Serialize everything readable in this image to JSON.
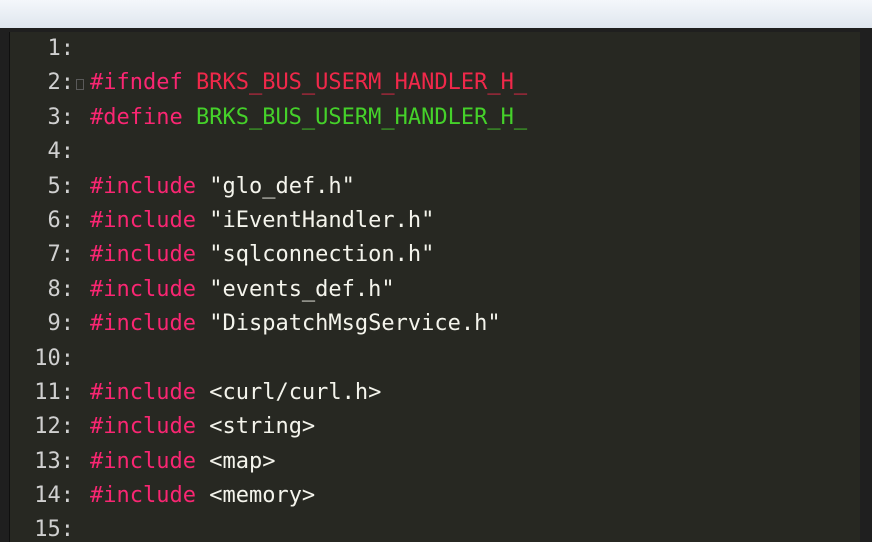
{
  "colors": {
    "background": "#272822",
    "keyword": "#f92672",
    "guard_macro": "#f0284a",
    "define_macro": "#45d12a",
    "text": "#f4f4ec",
    "line_number": "#d0d0d0"
  },
  "icons": {
    "fold_marker": "fold-marker-icon"
  },
  "lines": [
    {
      "num": "1:",
      "kw": "",
      "rest": ""
    },
    {
      "num": "2:",
      "kw": "#ifndef",
      "rest": "BRKS_BUS_USERM_HANDLER_H_"
    },
    {
      "num": "3:",
      "kw": "#define",
      "rest": "BRKS_BUS_USERM_HANDLER_H_"
    },
    {
      "num": "4:",
      "kw": "",
      "rest": ""
    },
    {
      "num": "5:",
      "kw": "#include",
      "rest": "\"glo_def.h\""
    },
    {
      "num": "6:",
      "kw": "#include",
      "rest": "\"iEventHandler.h\""
    },
    {
      "num": "7:",
      "kw": "#include",
      "rest": "\"sqlconnection.h\""
    },
    {
      "num": "8:",
      "kw": "#include",
      "rest": "\"events_def.h\""
    },
    {
      "num": "9:",
      "kw": "#include",
      "rest": "\"DispatchMsgService.h\""
    },
    {
      "num": "10:",
      "kw": "",
      "rest": ""
    },
    {
      "num": "11:",
      "kw": "#include",
      "rest": "<curl/curl.h>"
    },
    {
      "num": "12:",
      "kw": "#include",
      "rest": "<string>"
    },
    {
      "num": "13:",
      "kw": "#include",
      "rest": "<map>"
    },
    {
      "num": "14:",
      "kw": "#include",
      "rest": "<memory>"
    },
    {
      "num": "15:",
      "kw": "",
      "rest": ""
    }
  ]
}
